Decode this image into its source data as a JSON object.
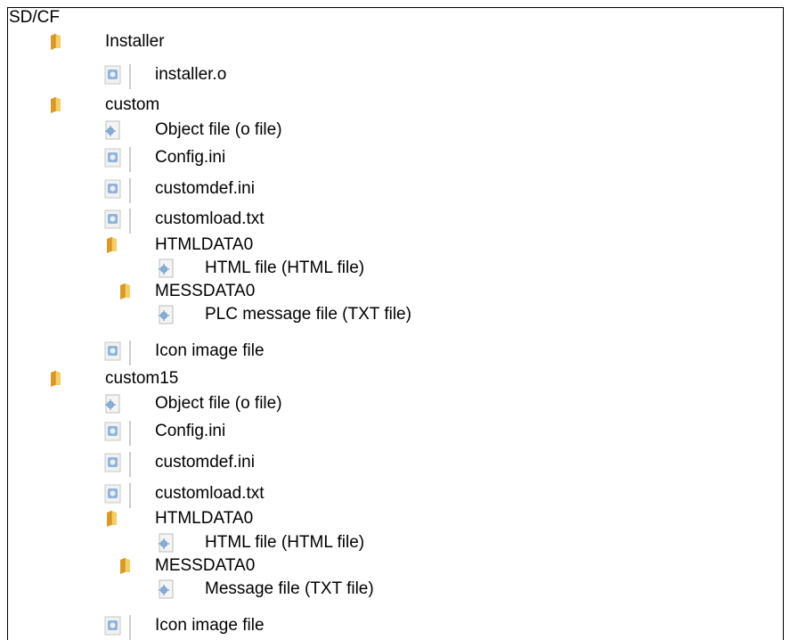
{
  "root_label": "SD/CF",
  "tree": [
    {
      "kind": "folder",
      "label": "Installer"
    },
    {
      "kind": "file",
      "label": "installer.o"
    },
    {
      "kind": "folder",
      "label": "custom"
    },
    {
      "kind": "config-file",
      "label": "Object file (o file)"
    },
    {
      "kind": "file",
      "label": "Config.ini"
    },
    {
      "kind": "file",
      "label": "customdef.ini"
    },
    {
      "kind": "file",
      "label": "customload.txt"
    },
    {
      "kind": "folder",
      "label": "HTMLDATA0"
    },
    {
      "kind": "config-file",
      "label": "HTML file (HTML file)"
    },
    {
      "kind": "folder",
      "label": "MESSDATA0"
    },
    {
      "kind": "config-file",
      "label": "PLC message file (TXT file)"
    },
    {
      "kind": "file",
      "label": "Icon image file"
    },
    {
      "kind": "folder",
      "label": "custom15"
    },
    {
      "kind": "config-file",
      "label": "Object file (o file)"
    },
    {
      "kind": "file",
      "label": "Config.ini"
    },
    {
      "kind": "file",
      "label": "customdef.ini"
    },
    {
      "kind": "file",
      "label": "customload.txt"
    },
    {
      "kind": "folder",
      "label": "HTMLDATA0"
    },
    {
      "kind": "config-file",
      "label": "HTML file (HTML file)"
    },
    {
      "kind": "folder",
      "label": "MESSDATA0"
    },
    {
      "kind": "config-file",
      "label": "Message file (TXT file)"
    },
    {
      "kind": "file",
      "label": "Icon image file"
    }
  ]
}
